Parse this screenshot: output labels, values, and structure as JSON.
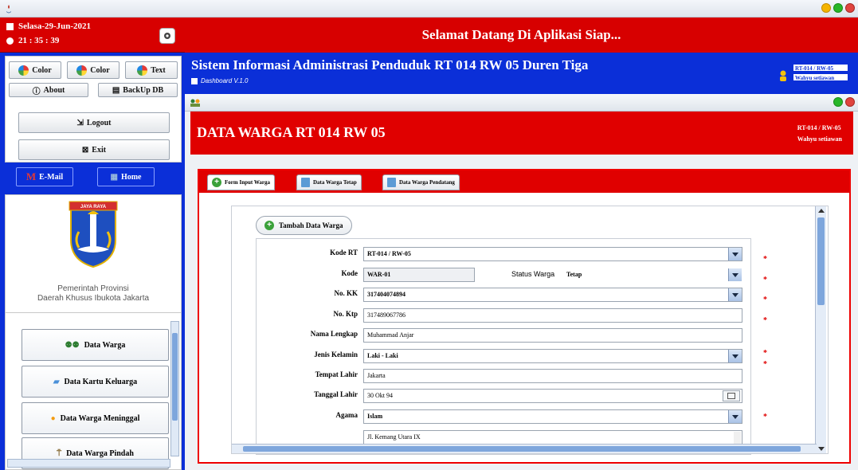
{
  "clock": {
    "date": "Selasa-29-Jun-2021",
    "time": "21 : 35 : 39"
  },
  "left": {
    "color_btn_1": "Color",
    "color_btn_2": "Color",
    "text_btn": "Text",
    "about_btn": "About",
    "backup_btn": "BackUp DB",
    "logout_btn": "Logout",
    "exit_btn": "Exit",
    "email_btn": "E-Mail",
    "home_btn": "Home",
    "logo_caption_1": "Pemerintah Provinsi",
    "logo_caption_2": "Daerah Khusus Ibukota Jakarta",
    "logo_banner": "JAYA RAYA",
    "menu": [
      "Data Warga",
      "Data Kartu Keluarga",
      "Data Warga Meninggal",
      "Data Warga Pindah"
    ]
  },
  "banner": {
    "text": "Selamat Datang Di Aplikasi Siap..."
  },
  "header": {
    "title": "Sistem Informasi Administrasi Penduduk RT 014 RW 05 Duren Tiga",
    "subtitle": "Dashboard V.1.0",
    "user_rt": "RT-014 / RW-05",
    "user_name": "Wahyu setiawan"
  },
  "inner": {
    "heading": "DATA WARGA RT 014 RW 05",
    "rt_label": "RT-014 / RW-05",
    "name_label": "Wahyu setiawan"
  },
  "tabs": [
    "Form Input Warga",
    "Data Warga Tetap",
    "Data Warga Pendatang"
  ],
  "form": {
    "add_button": "Tambah Data Warga",
    "kode_rt_label": "Kode RT",
    "kode_rt_value": "RT-014 / RW-05",
    "kode_label": "Kode",
    "kode_value": "WAR-01",
    "status_label": "Status Warga",
    "status_value": "Tetap",
    "no_kk_label": "No. KK",
    "no_kk_value": "317404074894",
    "no_ktp_label": "No. Ktp",
    "no_ktp_value": "317489067786",
    "nama_label": "Nama Lengkap",
    "nama_value": "Muhammad Anjar",
    "jk_label": "Jenis Kelamin",
    "jk_value": "Laki - Laki",
    "tempat_label": "Tempat Lahir",
    "tempat_value": "Jakarta",
    "tanggal_label": "Tanggal Lahir",
    "tanggal_value": "30 Okt 94",
    "agama_label": "Agama",
    "agama_value": "Islam",
    "alamat_value": "Jl. Kemang Utara IX"
  }
}
